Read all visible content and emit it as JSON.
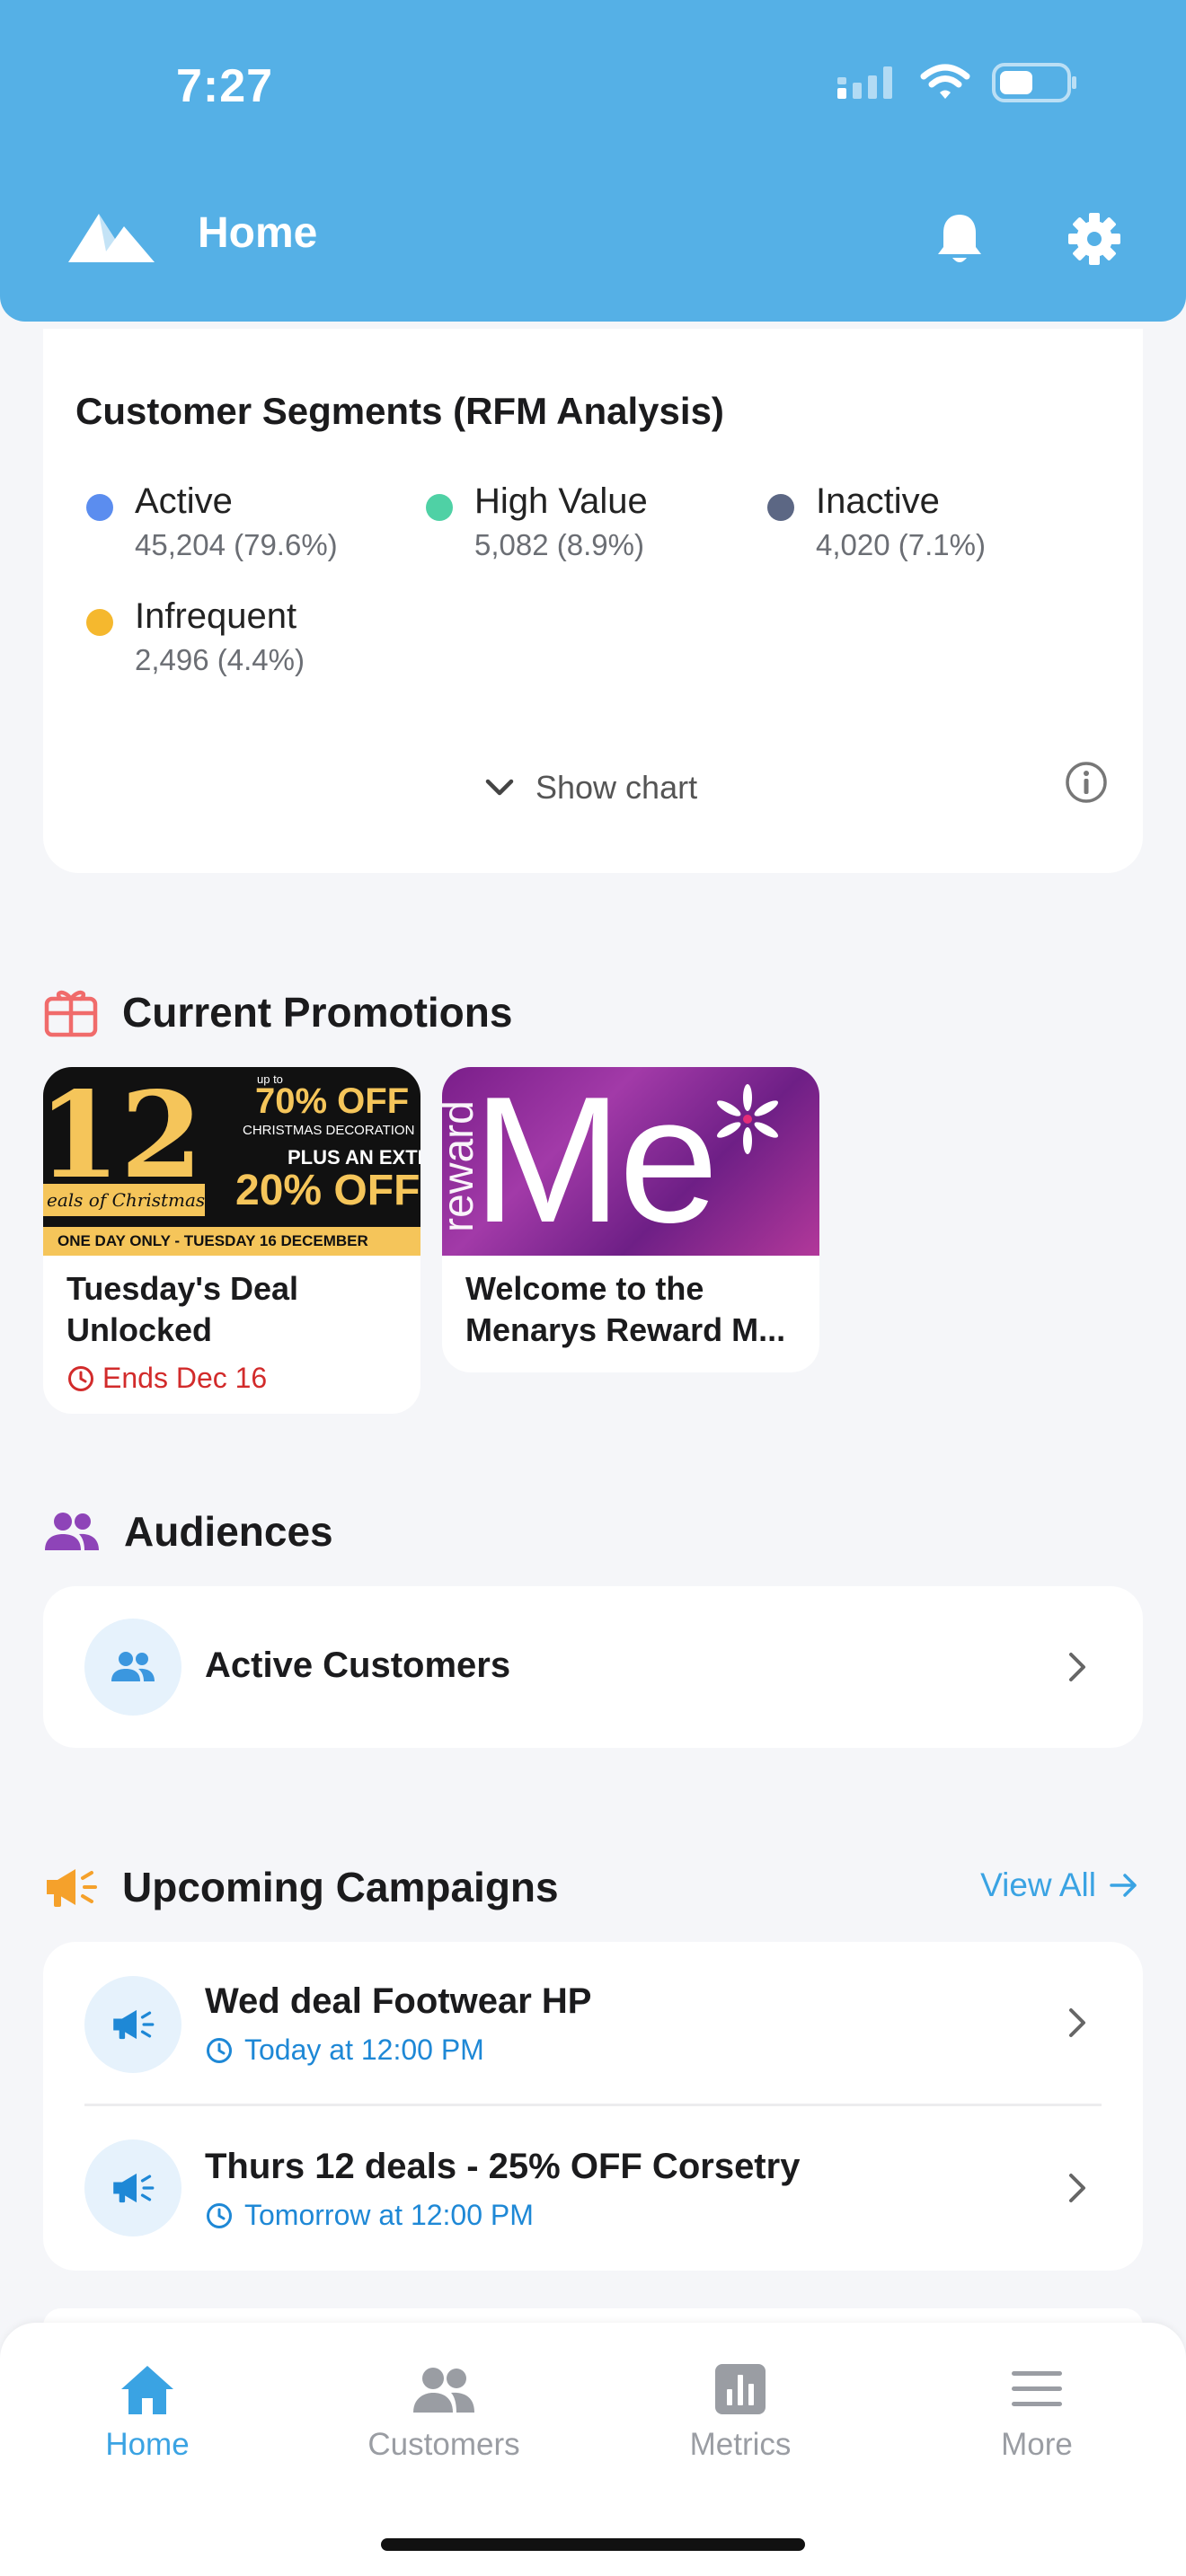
{
  "status_bar": {
    "time": "7:27"
  },
  "header": {
    "title": "Home"
  },
  "segments": {
    "title": "Customer Segments (RFM Analysis)",
    "items": [
      {
        "name": "Active",
        "value": "45,204 (79.6%)",
        "color": "#5B8DEF"
      },
      {
        "name": "High Value",
        "value": "5,082 (8.9%)",
        "color": "#4FD1A5"
      },
      {
        "name": "Inactive",
        "value": "4,020 (7.1%)",
        "color": "#5C6784"
      },
      {
        "name": "Infrequent",
        "value": "2,496 (4.4%)",
        "color": "#F5B82E"
      }
    ],
    "show_chart": "Show chart"
  },
  "promotions": {
    "title": "Current Promotions",
    "items": [
      {
        "title_line1": "Tuesday's Deal",
        "title_line2": "Unlocked",
        "ends": "Ends Dec 16"
      },
      {
        "title_line1": "Welcome to the",
        "title_line2": "Menarys Reward M..."
      }
    ],
    "banner1": {
      "big_number": "12",
      "script": "eals of Christmas",
      "upto": "up to",
      "off1": "70% OFF",
      "deco": "CHRISTMAS DECORATION",
      "extra": "PLUS AN EXTRA",
      "off2": "20% OFF",
      "strip": "ONE DAY ONLY - TUESDAY 16 DECEMBER"
    },
    "banner2": {
      "big": "Me",
      "side": "reward"
    }
  },
  "audiences": {
    "title": "Audiences",
    "items": [
      {
        "label": "Active Customers"
      }
    ]
  },
  "campaigns": {
    "title": "Upcoming Campaigns",
    "view_all": "View All",
    "items": [
      {
        "title": "Wed deal Footwear HP",
        "time": "Today at 12:00 PM"
      },
      {
        "title": "Thurs 12 deals - 25% OFF Corsetry",
        "time": "Tomorrow at 12:00 PM"
      }
    ]
  },
  "nav": {
    "items": [
      {
        "label": "Home",
        "active": true
      },
      {
        "label": "Customers"
      },
      {
        "label": "Metrics"
      },
      {
        "label": "More"
      }
    ]
  },
  "colors": {
    "header": "#55B0E6",
    "accent": "#3AA3E3",
    "link_blue": "#1E88D6",
    "danger": "#D22B2B",
    "nav_inactive": "#9A9DA3"
  }
}
